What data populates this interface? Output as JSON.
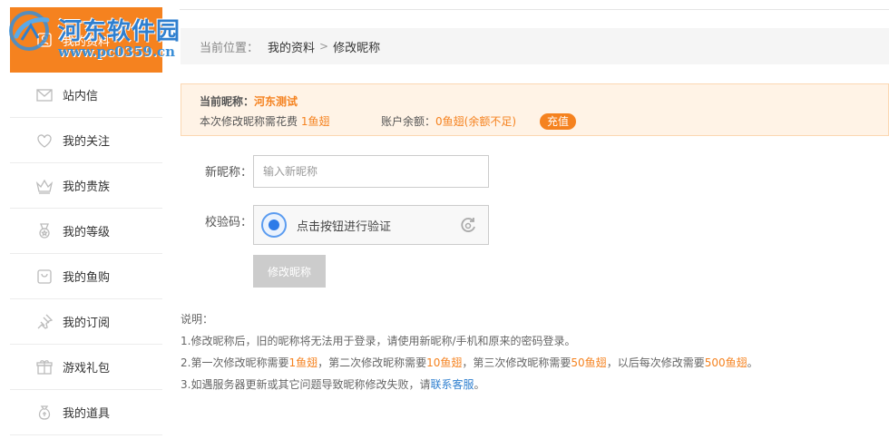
{
  "watermark": {
    "title": "河东软件园",
    "url": "www.pc0359.cn"
  },
  "sidebar": {
    "items": [
      {
        "label": "我的资料",
        "icon": "profile-icon"
      },
      {
        "label": "站内信",
        "icon": "mail-icon"
      },
      {
        "label": "我的关注",
        "icon": "heart-icon"
      },
      {
        "label": "我的贵族",
        "icon": "crown-icon"
      },
      {
        "label": "我的等级",
        "icon": "medal-icon"
      },
      {
        "label": "我的鱼购",
        "icon": "bag-icon"
      },
      {
        "label": "我的订阅",
        "icon": "pin-icon"
      },
      {
        "label": "游戏礼包",
        "icon": "gift-icon"
      },
      {
        "label": "我的道具",
        "icon": "pouch-icon"
      }
    ]
  },
  "breadcrumb": {
    "label": "当前位置：",
    "parent": "我的资料",
    "current": "修改昵称"
  },
  "notice": {
    "current_nick_label": "当前昵称：",
    "current_nick_value": "河东测试",
    "cost_prefix": "本次修改昵称需花费",
    "cost_value": "1鱼翅",
    "balance_label": "账户余额：",
    "balance_value": "0鱼翅(余额不足)",
    "recharge": "充值"
  },
  "form": {
    "nick_label": "新昵称：",
    "nick_placeholder": "输入新昵称",
    "captcha_label": "校验码：",
    "captcha_text": "点击按钮进行验证",
    "submit": "修改昵称"
  },
  "notes": {
    "title": "说明：",
    "line1": "1.修改昵称后，旧的昵称将无法用于登录，请使用新昵称/手机和原来的密码登录。",
    "line2_parts": [
      "2.第一次修改昵称需要",
      "1鱼翅",
      "，第二次修改昵称需要",
      "10鱼翅",
      "，第三次修改昵称需要",
      "50鱼翅",
      "，以后每次修改需要",
      "500鱼翅",
      "。"
    ],
    "line3_prefix": "3.如遇服务器更新或其它问题导致昵称修改失败，请",
    "line3_link": "联系客服",
    "line3_suffix": "。"
  },
  "colors": {
    "accent": "#f5821f",
    "link": "#2f7fcf",
    "captcha_blue": "#2d7be8"
  }
}
